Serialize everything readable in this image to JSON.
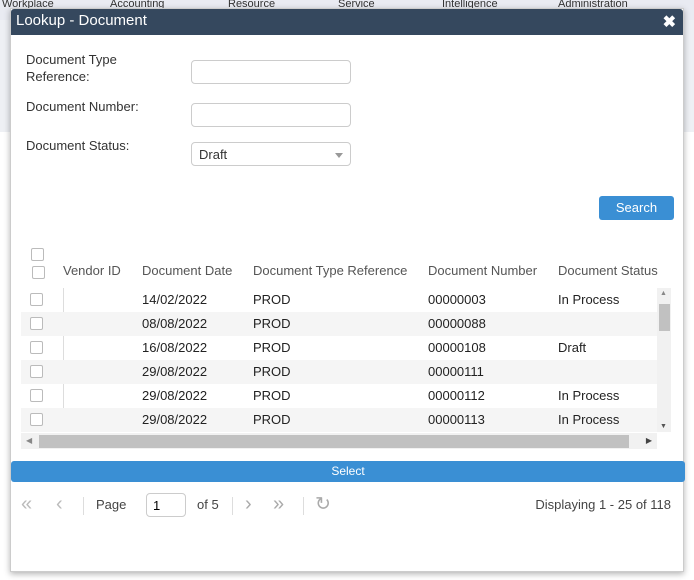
{
  "background": {
    "nav": [
      "Workplace",
      "Accounting",
      "Resource",
      "Service",
      "Intelligence",
      "Administration"
    ]
  },
  "dialog": {
    "title": "Lookup - Document"
  },
  "form": {
    "doc_type_ref_label": "Document Type Reference:",
    "doc_type_ref_value": "",
    "doc_number_label": "Document Number:",
    "doc_number_value": "",
    "doc_status_label": "Document Status:",
    "doc_status_value": "Draft",
    "search_label": "Search"
  },
  "table": {
    "columns": [
      "Vendor ID",
      "Document Date",
      "Document Type Reference",
      "Document Number",
      "Document Status"
    ],
    "rows": [
      {
        "vendor": "",
        "date": "14/02/2022",
        "type": "PROD",
        "number": "00000003",
        "status": "In Process"
      },
      {
        "vendor": "",
        "date": "08/08/2022",
        "type": "PROD",
        "number": "00000088",
        "status": ""
      },
      {
        "vendor": "",
        "date": "16/08/2022",
        "type": "PROD",
        "number": "00000108",
        "status": "Draft"
      },
      {
        "vendor": "",
        "date": "29/08/2022",
        "type": "PROD",
        "number": "00000111",
        "status": ""
      },
      {
        "vendor": "",
        "date": "29/08/2022",
        "type": "PROD",
        "number": "00000112",
        "status": "In Process"
      },
      {
        "vendor": "",
        "date": "29/08/2022",
        "type": "PROD",
        "number": "00000113",
        "status": "In Process"
      }
    ]
  },
  "select_label": "Select",
  "pager": {
    "page_label": "Page",
    "page": "1",
    "of_label": "of 5",
    "display": "Displaying 1 - 25 of 118"
  },
  "colors": {
    "header": "#35485e",
    "accent": "#3a8fd4"
  }
}
